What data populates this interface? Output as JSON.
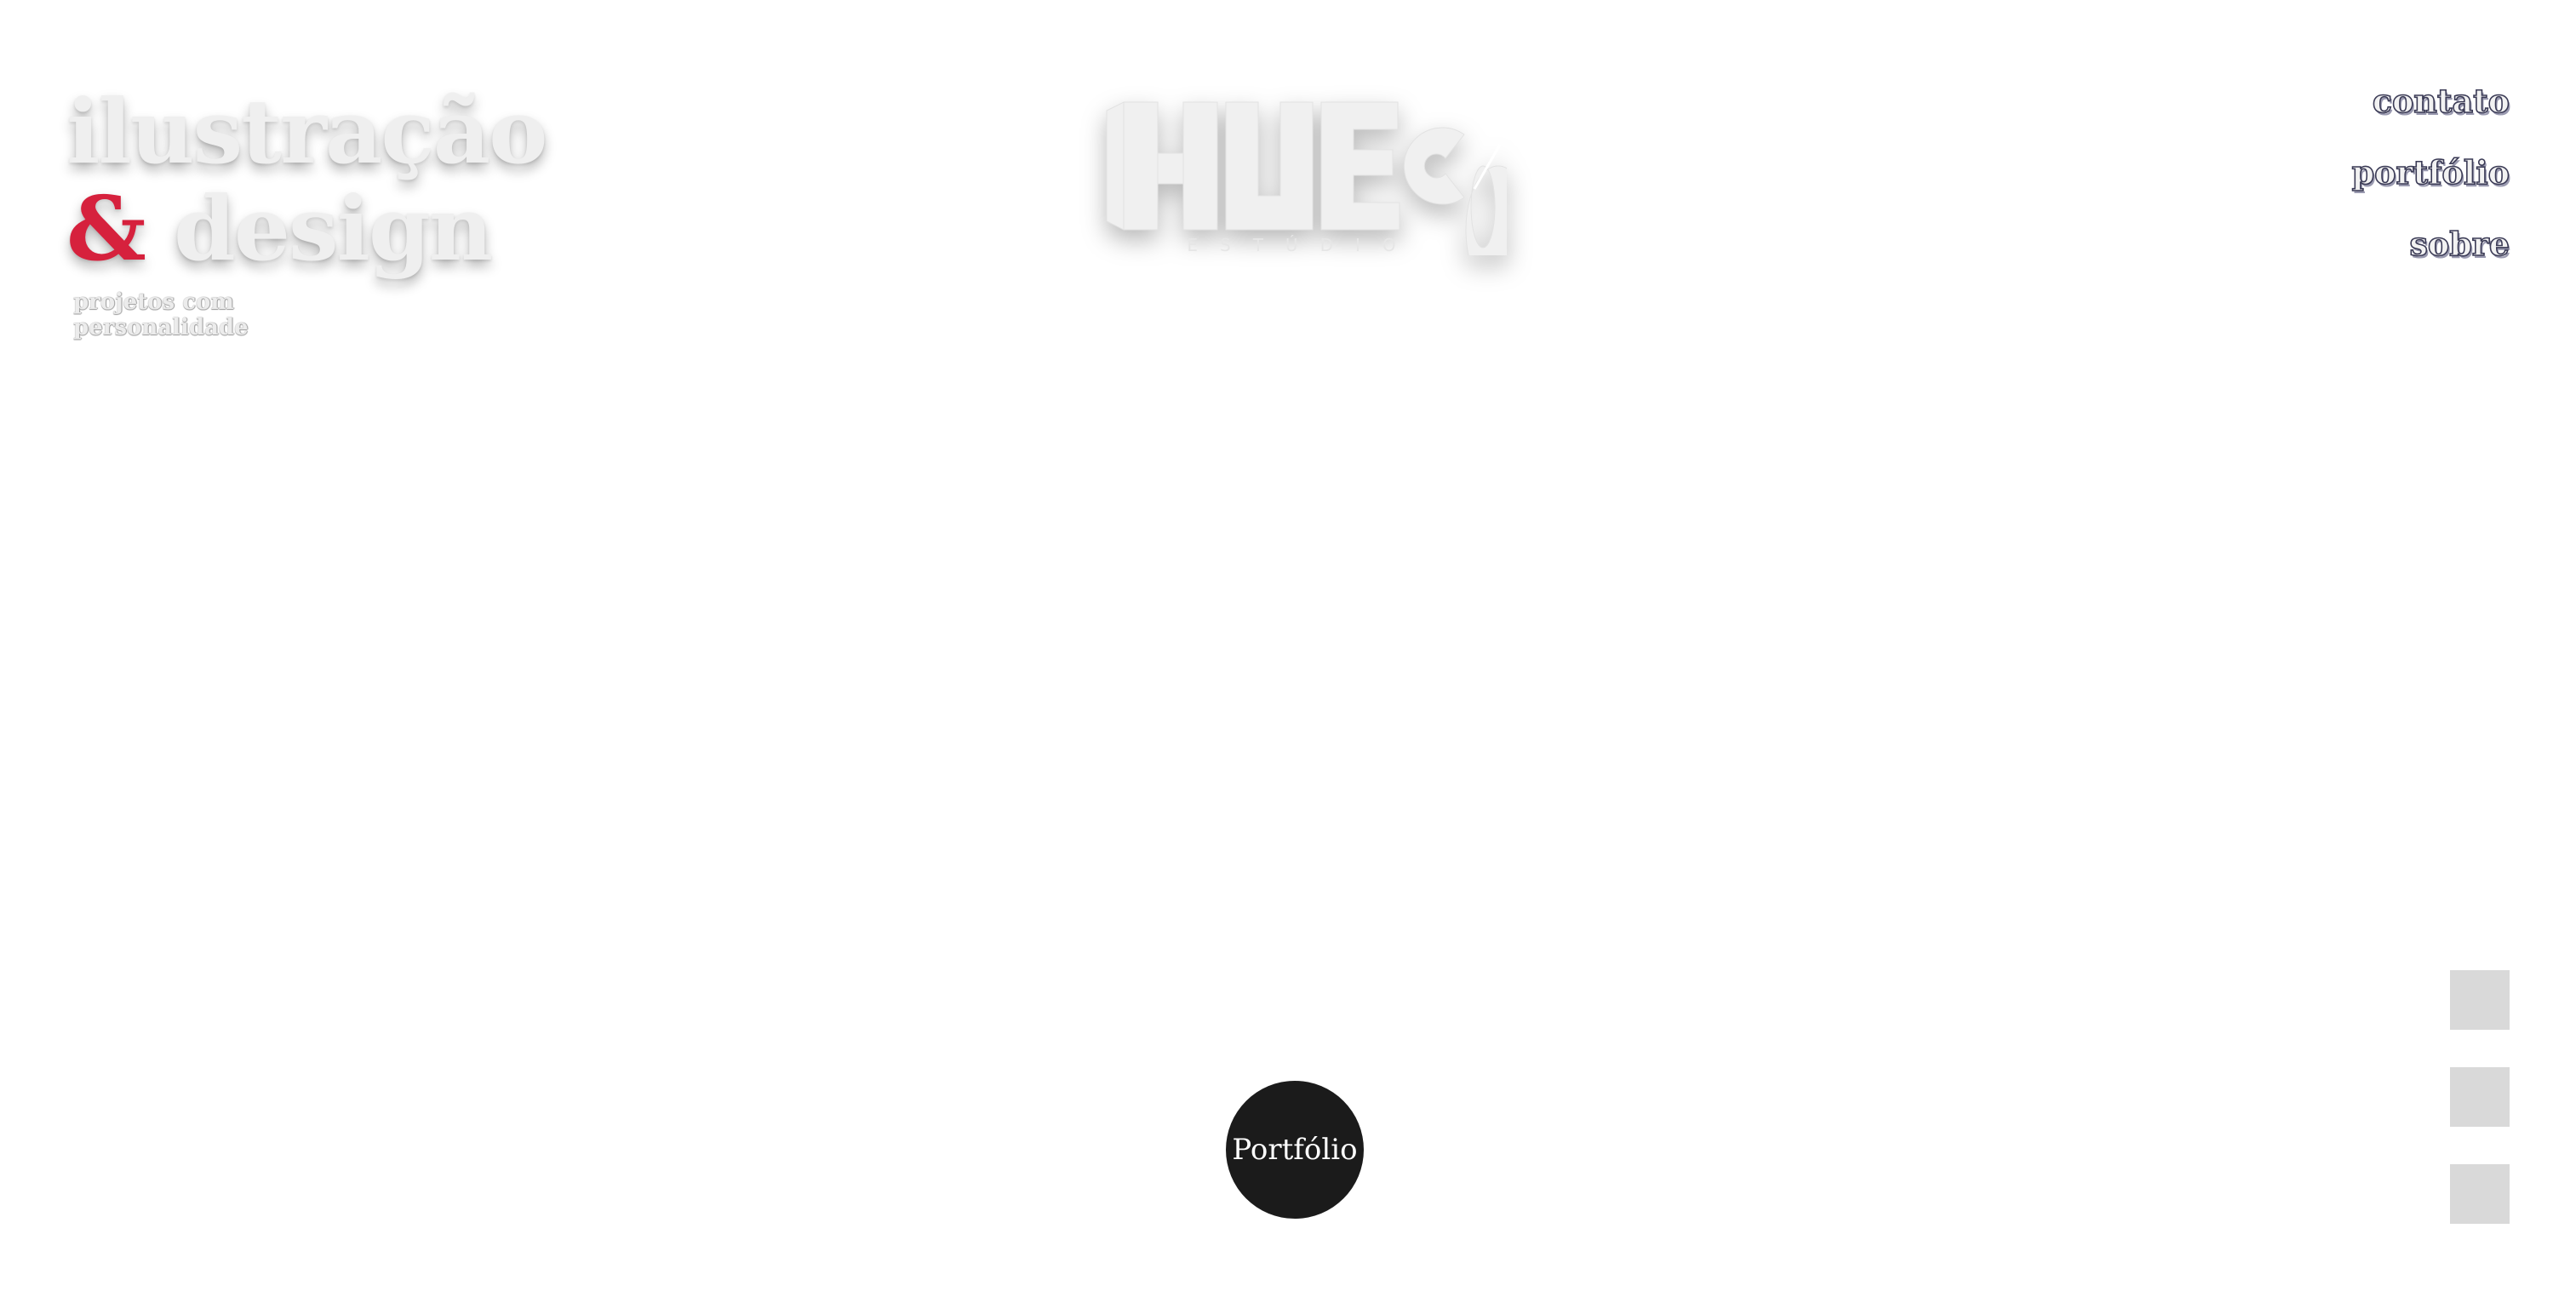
{
  "hero": {
    "line1": "ilustração",
    "ampersand": "&",
    "line2_rest": " design",
    "subtitle": "projetos com personalidade"
  },
  "logo": {
    "wordmark": "HUECO",
    "subtext": "ESTÚDIO",
    "icon": "hueco-logo"
  },
  "nav": {
    "items": [
      {
        "label": "contato"
      },
      {
        "label": "portfólio"
      },
      {
        "label": "sobre"
      }
    ]
  },
  "cta": {
    "label": "Portfólio"
  },
  "social": {
    "icons": [
      "social-link-1",
      "social-link-2",
      "social-link-3"
    ]
  },
  "colors": {
    "accent": "#d6213d",
    "button_bg": "#1b1b1b",
    "placeholder": "#d9d9d9"
  }
}
